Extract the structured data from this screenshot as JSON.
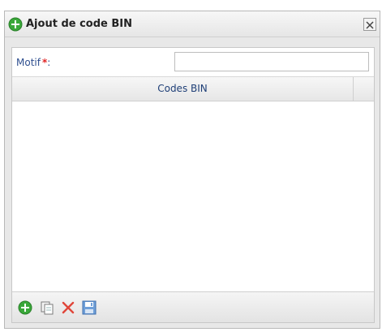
{
  "dialog": {
    "title": "Ajout de code BIN",
    "title_icon": "add-circle-icon",
    "close_icon": "close-icon"
  },
  "form": {
    "motif_label": "Motif",
    "required_mark": "*",
    "label_suffix": ":",
    "motif_value": ""
  },
  "grid": {
    "columns": [
      "Codes BIN"
    ],
    "rows": []
  },
  "toolbar": {
    "buttons": [
      {
        "name": "add",
        "icon": "add-circle-icon"
      },
      {
        "name": "copy",
        "icon": "copy-icon"
      },
      {
        "name": "delete",
        "icon": "delete-x-icon"
      },
      {
        "name": "save",
        "icon": "save-disk-icon"
      }
    ]
  },
  "colors": {
    "accent_green": "#3aa83a",
    "label_blue": "#2f4f8f",
    "required_red": "#e12424",
    "delete_red": "#e0463a"
  }
}
